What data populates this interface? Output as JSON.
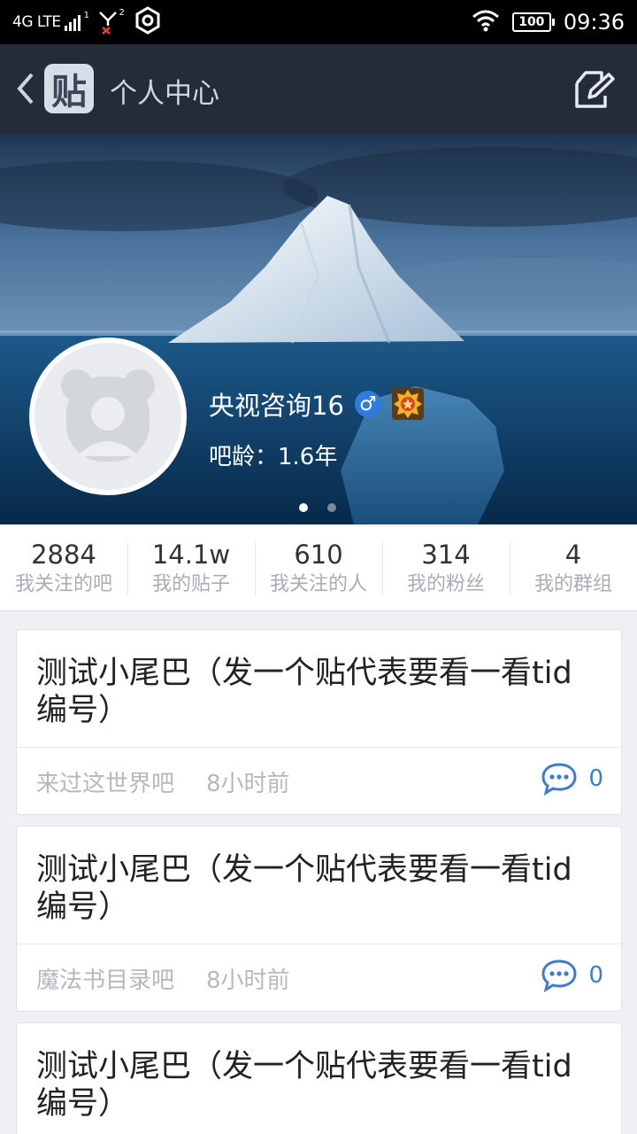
{
  "status_bar": {
    "network": "4G LTE",
    "sim1": "1",
    "sim2": "2",
    "battery": "100",
    "time": "09:36"
  },
  "nav": {
    "logo_char": "贴",
    "title": "个人中心"
  },
  "profile": {
    "username": "央视咨询16",
    "gender_symbol": "♂",
    "ba_age": "吧龄：1.6年",
    "carousel_total": 2,
    "carousel_active": 1
  },
  "stats": [
    {
      "value": "2884",
      "label": "我关注的吧"
    },
    {
      "value": "14.1w",
      "label": "我的贴子"
    },
    {
      "value": "610",
      "label": "我关注的人"
    },
    {
      "value": "314",
      "label": "我的粉丝"
    },
    {
      "value": "4",
      "label": "我的群组"
    }
  ],
  "posts": [
    {
      "title": "测试小尾巴（发一个贴代表要看一看tid编号）",
      "forum": "来过这世界吧",
      "time": "8小时前",
      "replies": "0"
    },
    {
      "title": "测试小尾巴（发一个贴代表要看一看tid编号）",
      "forum": "魔法书目录吧",
      "time": "8小时前",
      "replies": "0"
    },
    {
      "title": "测试小尾巴（发一个贴代表要看一看tid编号）"
    }
  ],
  "colors": {
    "nav_bg": "#242c3a",
    "accent_blue": "#3e7ccc",
    "gender_blue": "#2f7be0"
  },
  "icons": [
    "back-icon",
    "tieba-logo",
    "edit-icon",
    "wifi-icon",
    "signal-icon",
    "settings-icon",
    "comment-icon",
    "male-icon",
    "medal-icon"
  ]
}
